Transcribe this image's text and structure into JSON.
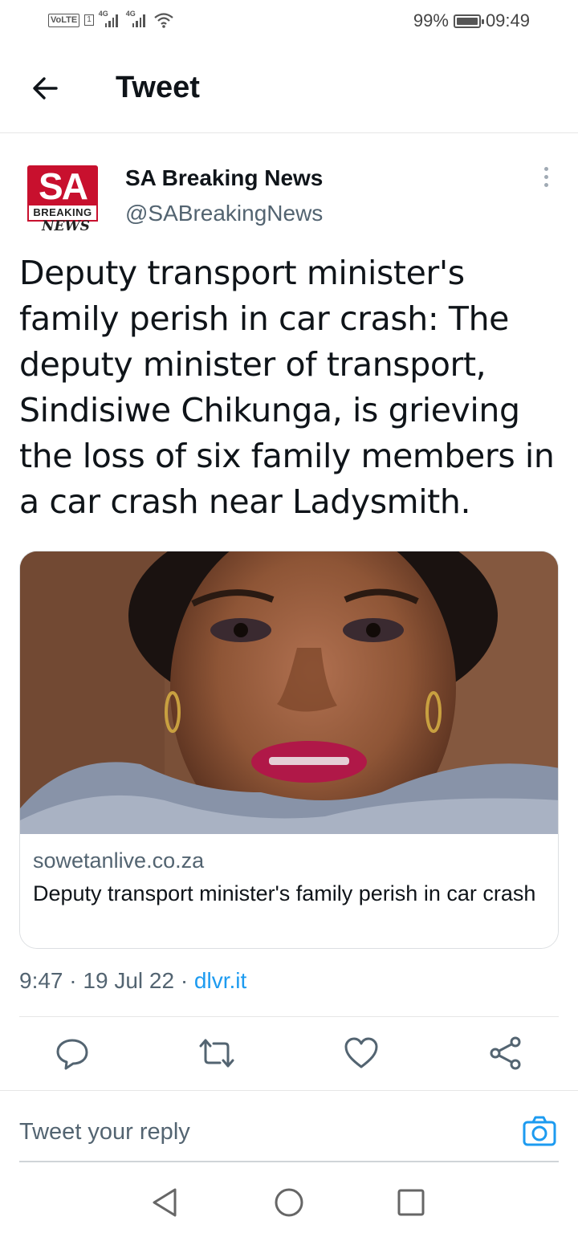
{
  "status_bar": {
    "volte": "VoLTE",
    "sim": "1",
    "network_1": "4G",
    "network_2": "4G",
    "battery": "99%",
    "time": "09:49"
  },
  "header": {
    "title": "Tweet"
  },
  "author": {
    "name": "SA Breaking News",
    "handle": "@SABreakingNews"
  },
  "logo": {
    "line1": "SA",
    "line2": "BREAKING",
    "line3": "NEWS"
  },
  "tweet": {
    "text": "Deputy transport minister's family perish in car crash: The deputy minister of transport, Sindisiwe Chikunga, is grieving the loss of six family members in a car crash near Ladysmith.",
    "time": "9:47",
    "date": "19 Jul 22",
    "source": "dlvr.it",
    "separator": "·"
  },
  "card": {
    "domain": "sowetanlive.co.za",
    "title": "Deputy transport minister's family perish in car crash"
  },
  "reply": {
    "placeholder": "Tweet your reply"
  },
  "colors": {
    "accent": "#1d9bf0",
    "brand_red": "#c8102e",
    "text": "#0f1419",
    "muted": "#536471"
  },
  "icons": {
    "back": "arrow-left-icon",
    "more": "more-vertical-icon",
    "reply": "reply-icon",
    "retweet": "retweet-icon",
    "like": "heart-icon",
    "share": "share-icon",
    "camera": "camera-icon"
  }
}
